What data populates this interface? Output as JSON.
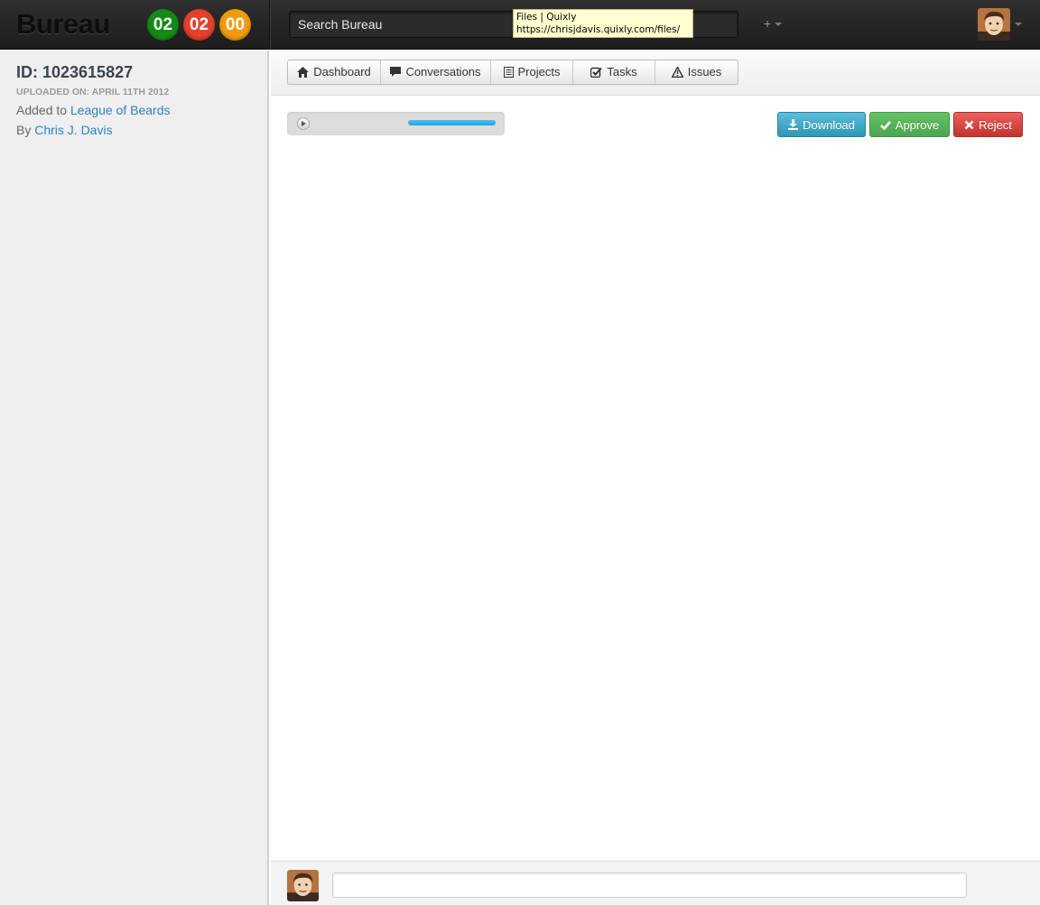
{
  "app": {
    "name": "Bureau"
  },
  "counters": [
    {
      "label": "02",
      "color": "#168a16"
    },
    {
      "label": "02",
      "color": "#e4402a"
    },
    {
      "label": "00",
      "color": "#f29a0e"
    }
  ],
  "search": {
    "placeholder": "Search Bureau",
    "value": "Search Bureau"
  },
  "tooltip": {
    "title": "Files | Quixly",
    "url": "https://chrisjdavis.quixly.com/files/"
  },
  "header": {
    "plus_menu_label": "+"
  },
  "sidebar": {
    "file_id": "ID: 1023615827",
    "uploaded": "UPLOADED ON: APRIL 11TH 2012",
    "added_prefix": "Added to",
    "added_link": "League of Beards",
    "by_prefix": "By",
    "by_link": "Chris J. Davis"
  },
  "nav": {
    "items": [
      {
        "label": "Dashboard",
        "icon": "home-icon"
      },
      {
        "label": "Conversations",
        "icon": "comment-icon"
      },
      {
        "label": "Projects",
        "icon": "list-icon"
      },
      {
        "label": "Tasks",
        "icon": "check-icon"
      },
      {
        "label": "Issues",
        "icon": "warning-icon"
      }
    ]
  },
  "player": {
    "progress": 1.0
  },
  "actions": {
    "download": "Download",
    "approve": "Approve",
    "reject": "Reject"
  },
  "colors": {
    "link": "#2a83c5",
    "download": "#5bc0de",
    "approve": "#62c462",
    "reject": "#ee5f5b",
    "progress": "#1ba1df"
  }
}
